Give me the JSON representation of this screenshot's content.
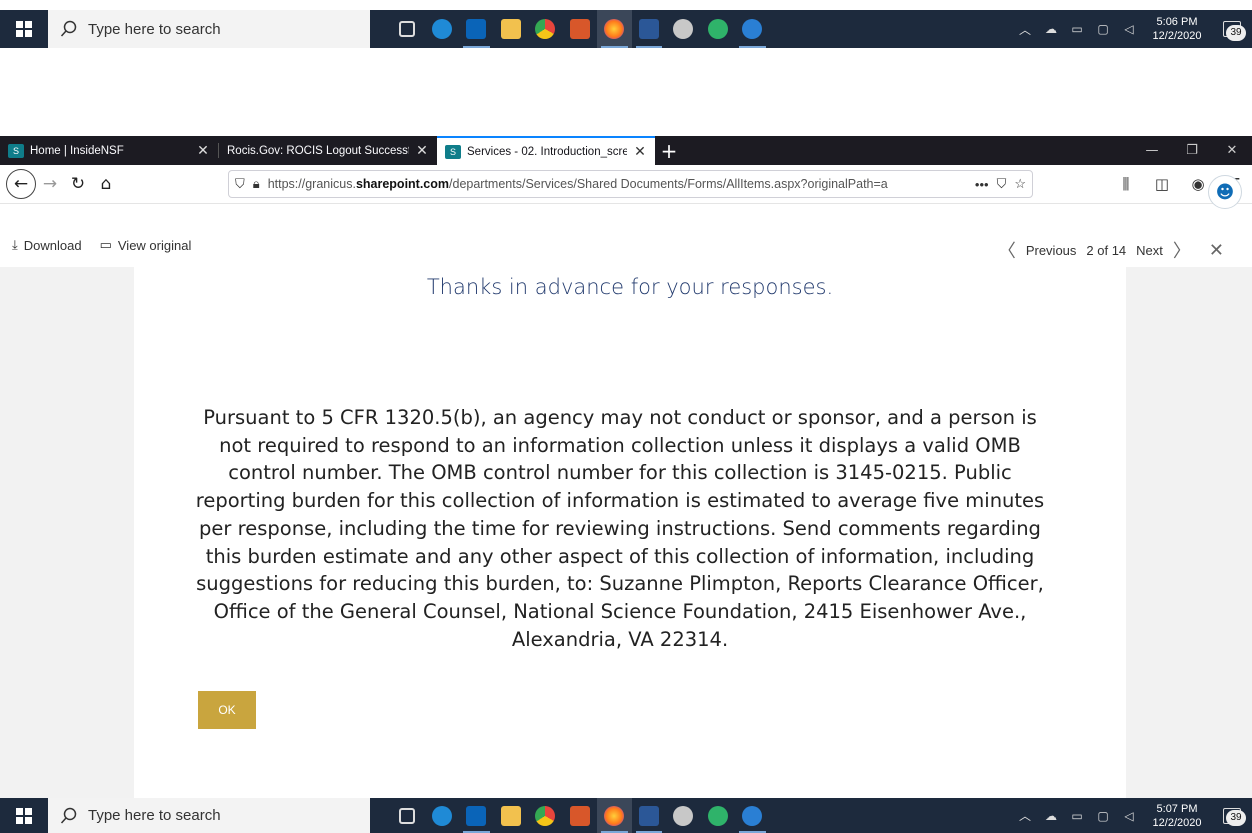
{
  "taskbar": {
    "search_placeholder": "Type here to search",
    "top_clock": {
      "time": "5:06 PM",
      "date": "12/2/2020"
    },
    "bottom_clock": {
      "time": "5:07 PM",
      "date": "12/2/2020"
    },
    "notification_count": "39",
    "apps": [
      {
        "name": "task-view",
        "color": "#1d2a3d"
      },
      {
        "name": "edge",
        "color": "#1f8ad6"
      },
      {
        "name": "outlook",
        "color": "#0a64b8"
      },
      {
        "name": "file-explorer",
        "color": "#f2c14e"
      },
      {
        "name": "chrome",
        "color": "#e8453c"
      },
      {
        "name": "office",
        "color": "#d8572a"
      },
      {
        "name": "firefox",
        "color": "#ff7a1a"
      },
      {
        "name": "word",
        "color": "#2b5797"
      },
      {
        "name": "paint",
        "color": "#c8c8c8"
      },
      {
        "name": "app-green",
        "color": "#2fb36a"
      },
      {
        "name": "app-blue-chat",
        "color": "#2a7fd4"
      }
    ]
  },
  "browser": {
    "tabs": [
      {
        "title": "Home | InsideNSF",
        "favicon": "S"
      },
      {
        "title": "Rocis.Gov: ROCIS Logout Successful",
        "favicon": ""
      },
      {
        "title": "Services - 02. Introduction_scre",
        "favicon": "S"
      }
    ],
    "url": {
      "prefix": "https://granicus.",
      "domain": "sharepoint.com",
      "path": "/departments/Services/Shared Documents/Forms/AllItems.aspx?originalPath=a"
    }
  },
  "viewer": {
    "download_label": "Download",
    "view_original_label": "View original",
    "previous_label": "Previous",
    "page_counter": "2 of 14",
    "next_label": "Next"
  },
  "document": {
    "thanks": "Thanks in advance for your responses.",
    "notice": "Pursuant to 5 CFR 1320.5(b), an agency may not conduct or sponsor, and a person is not required to respond to an information collection unless it displays a valid OMB control number. The OMB control number for this collection is 3145-0215. Public reporting burden for this collection of information is estimated to average five minutes per response, including the time for reviewing instructions. Send comments regarding this burden estimate and any other aspect of this collection of information, including suggestions for reducing this burden, to: Suzanne Plimpton, Reports Clearance Officer, Office of the General Counsel, National Science Foundation, 2415 Eisenhower Ave., Alexandria, VA 22314.",
    "ok_label": "OK"
  },
  "colors": {
    "taskbar": "#1d2a3d",
    "tabbar": "#1c1b22",
    "accent_tab": "#0a84ff",
    "ok_button": "#c9a53e",
    "heading": "#233b6e"
  }
}
